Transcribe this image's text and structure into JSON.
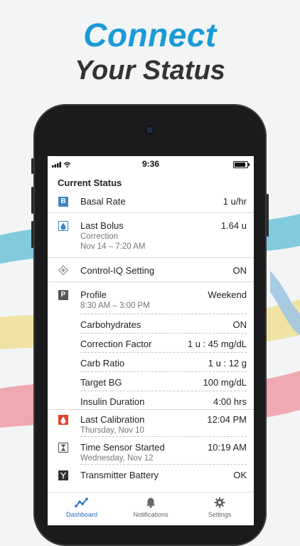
{
  "promo": {
    "headline_1": "Connect",
    "headline_2": "Your Status"
  },
  "status_bar": {
    "time": "9:36"
  },
  "section_title": "Current Status",
  "rows": {
    "basal": {
      "icon": "B",
      "label": "Basal Rate",
      "value": "1 u/hr"
    },
    "bolus": {
      "label": "Last Bolus",
      "value": "1.64 u",
      "sub1": "Correction",
      "sub2": "Nov 14 – 7:20 AM"
    },
    "controliq": {
      "label": "Control-IQ Setting",
      "value": "ON"
    },
    "profile": {
      "icon": "P",
      "label": "Profile",
      "value": "Weekend",
      "sub": "8:30 AM – 3:00 PM"
    },
    "carbs": {
      "label": "Carbohydrates",
      "value": "ON"
    },
    "correction": {
      "label": "Correction Factor",
      "value": "1 u : 45 mg/dL"
    },
    "carb_ratio": {
      "label": "Carb Ratio",
      "value": "1 u : 12 g"
    },
    "target_bg": {
      "label": "Target BG",
      "value": "100 mg/dL"
    },
    "insulin_duration": {
      "label": "Insulin Duration",
      "value": "4:00 hrs"
    },
    "calibration": {
      "label": "Last Calibration",
      "value": "12:04 PM",
      "sub": "Thursday, Nov 10"
    },
    "sensor": {
      "label": "Time Sensor Started",
      "value": "10:19 AM",
      "sub": "Wednesday, Nov 12"
    },
    "transmitter": {
      "label": "Transmitter Battery",
      "value": "OK"
    }
  },
  "tabs": [
    {
      "label": "Dashboard",
      "icon": "chart-line-icon"
    },
    {
      "label": "Notifications",
      "icon": "bell-icon"
    },
    {
      "label": "Settings",
      "icon": "gear-icon"
    }
  ],
  "colors": {
    "accent": "#1a9ad6",
    "tab_active": "#1a6fc9",
    "basal_icon": "#3d85c6",
    "calibration_icon": "#e0442f"
  }
}
